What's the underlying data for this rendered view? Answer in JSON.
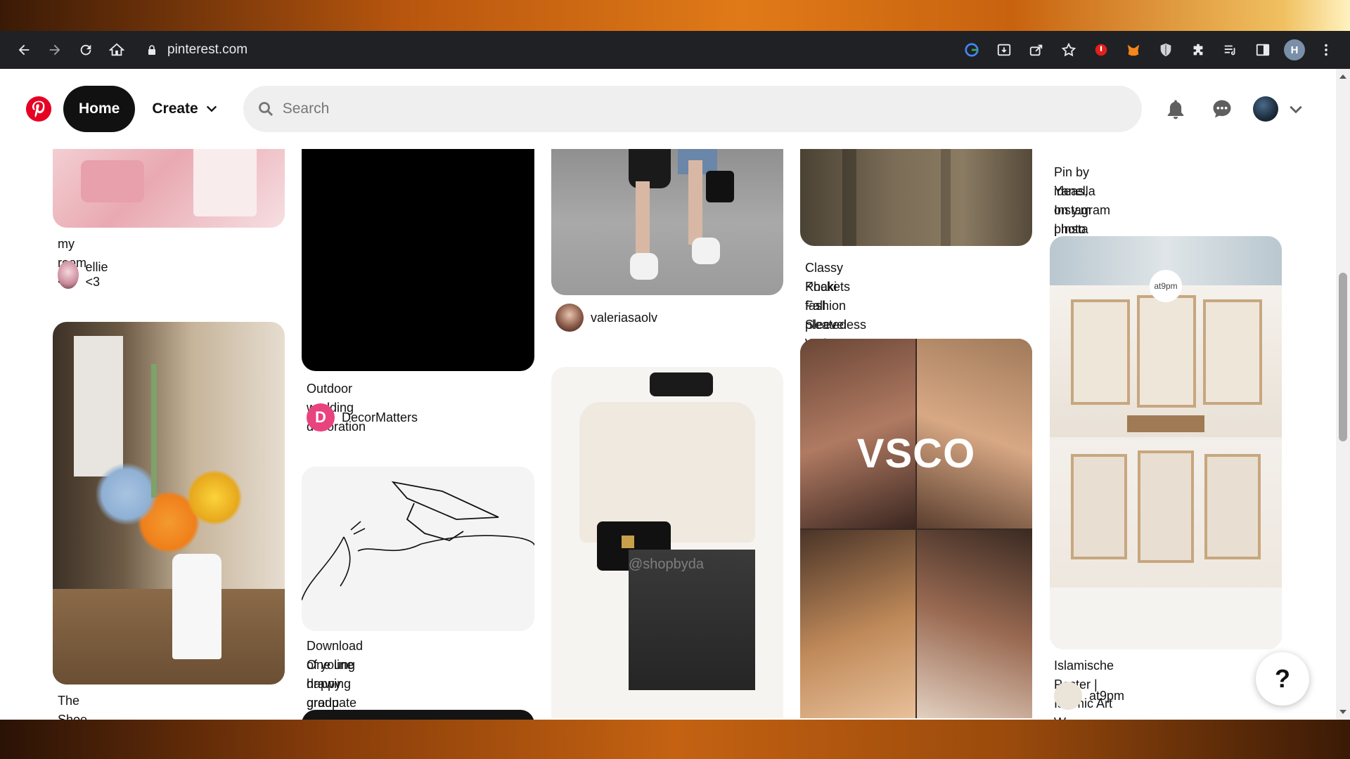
{
  "browser": {
    "url": "pinterest.com",
    "profile_initial": "H"
  },
  "header": {
    "home_label": "Home",
    "create_label": "Create",
    "search_placeholder": "Search"
  },
  "pins": {
    "col1": [
      {
        "title": "my room <3",
        "user": "ellie <3"
      },
      {
        "title": "The Shoe Vase"
      }
    ],
    "col2": [
      {
        "title": "Outdoor wedding decoration",
        "user": "DecorMatters"
      },
      {
        "title_line1": "Download One line drawing group",
        "title_line2": "of young happy graduate hand's..."
      }
    ],
    "col3": [
      {
        "user": "valeriasaolv"
      },
      {
        "watermark": "@shopbyda"
      }
    ],
    "col4": [
      {
        "title_line1": "Classy Khaki fashion pleated",
        "title_line2": "Pockets Fall Sleeveless Waistcoat"
      },
      {
        "overlay": "VSCO"
      }
    ],
    "col5": [
      {
        "title_line1": "Pin by Yanella on y.m | Insta photo",
        "title_line2": "ideas, Instagram photo inspiratio..."
      },
      {
        "title": "Islamische Poster | Islamic Art W",
        "user": "at9pm",
        "badge": "at9pm"
      }
    ]
  },
  "help": {
    "label": "?"
  },
  "colors": {
    "pinterest_red": "#e60023",
    "home_bg": "#111111",
    "search_bg": "#efefef"
  }
}
